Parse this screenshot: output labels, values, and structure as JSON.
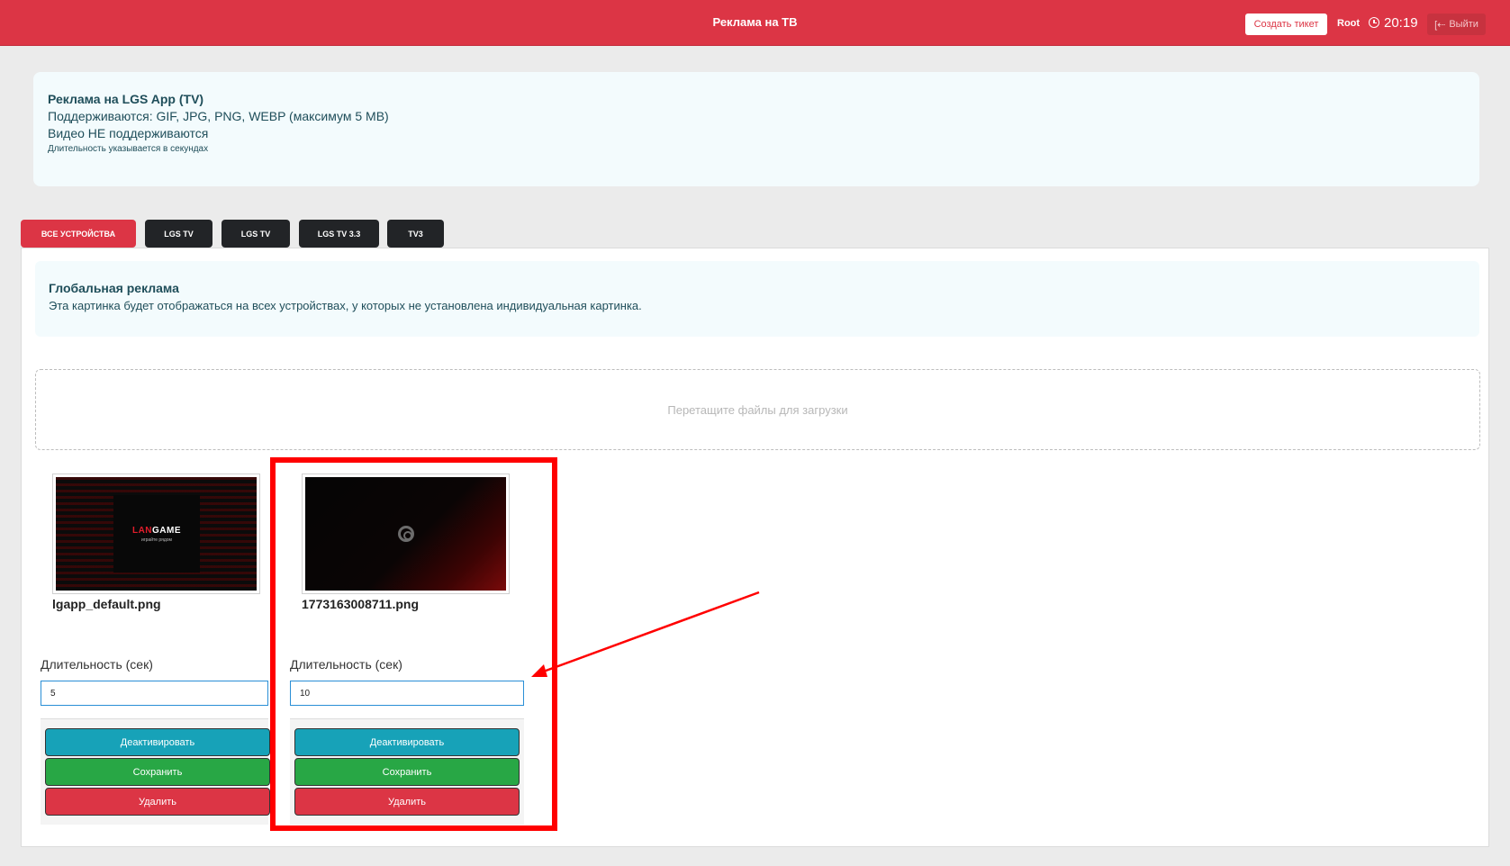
{
  "header": {
    "title": "Реклама на ТВ",
    "create_ticket_label": "Создать тикет",
    "user": "Root",
    "time": "20:19",
    "logout_label": "Выйти",
    "bg_color": "#dc3545"
  },
  "info": {
    "title": "Реклама на LGS App (TV)",
    "formats": "Поддерживаются: GIF, JPG, PNG, WEBP (максимум 5 MB)",
    "video": "Видео НЕ поддерживаются",
    "duration_note": "Длительность указывается в секундах"
  },
  "tabs": [
    {
      "label": "ВСЕ УСТРОЙСТВА",
      "active": true
    },
    {
      "label": "LGS TV",
      "active": false
    },
    {
      "label": "LGS TV",
      "active": false
    },
    {
      "label": "LGS TV 3.3",
      "active": false
    },
    {
      "label": "TV3",
      "active": false
    }
  ],
  "global": {
    "title": "Глобальная реклама",
    "description": "Эта картинка будет отображаться на всех устройствах, у которых не установлена индивидуальная картинка."
  },
  "dropzone": {
    "text": "Перетащите файлы для загрузки"
  },
  "ads": [
    {
      "filename": "lgapp_default.png",
      "image_logo": "LANGAME",
      "image_logo_red_part": "LAN",
      "image_logo_white_part": "GAME",
      "image_sub": "играйте рядом",
      "duration_label": "Длительность (сек)",
      "duration_value": "5",
      "deactivate_label": "Деактивировать",
      "save_label": "Сохранить",
      "delete_label": "Удалить"
    },
    {
      "filename": "1773163008711.png",
      "duration_label": "Длительность (сек)",
      "duration_value": "10",
      "deactivate_label": "Деактивировать",
      "save_label": "Сохранить",
      "delete_label": "Удалить"
    }
  ],
  "annotation": {
    "color": "#ff0000",
    "shape": "rectangle-and-arrow"
  }
}
